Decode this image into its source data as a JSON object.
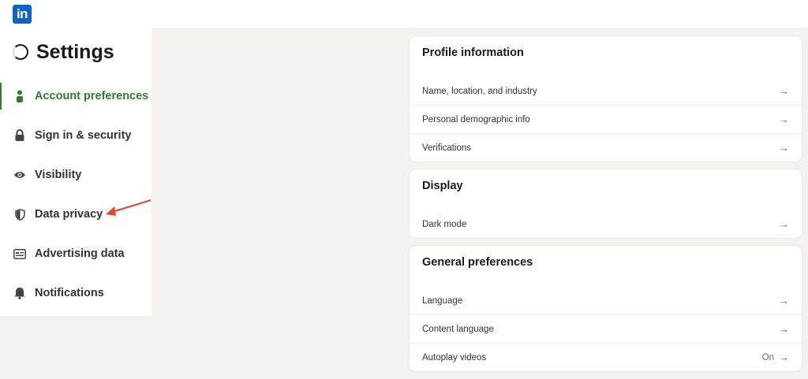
{
  "topbar": {
    "logo_text": "in",
    "brand_color": "#0a66c2"
  },
  "sidebar": {
    "title": "Settings",
    "accent_color": "#2e7d32",
    "items": [
      {
        "label": "Account preferences",
        "icon": "person-icon",
        "active": true
      },
      {
        "label": "Sign in & security",
        "icon": "lock-icon",
        "active": false
      },
      {
        "label": "Visibility",
        "icon": "eye-icon",
        "active": false
      },
      {
        "label": "Data privacy",
        "icon": "shield-icon",
        "active": false
      },
      {
        "label": "Advertising data",
        "icon": "ad-icon",
        "active": false
      },
      {
        "label": "Notifications",
        "icon": "bell-icon",
        "active": false
      }
    ]
  },
  "sections": {
    "profile": {
      "title": "Profile information",
      "rows": [
        {
          "label": "Name, location, and industry"
        },
        {
          "label": "Personal demographic info"
        },
        {
          "label": "Verifications"
        }
      ]
    },
    "display": {
      "title": "Display",
      "rows": [
        {
          "label": "Dark mode"
        }
      ]
    },
    "general": {
      "title": "General preferences",
      "rows": [
        {
          "label": "Language"
        },
        {
          "label": "Content language"
        },
        {
          "label": "Autoplay videos",
          "value": "On"
        }
      ]
    }
  },
  "arrow_glyph": "→",
  "annotation": {
    "color": "#e5452f",
    "icon": "red-arrow-annotation"
  }
}
